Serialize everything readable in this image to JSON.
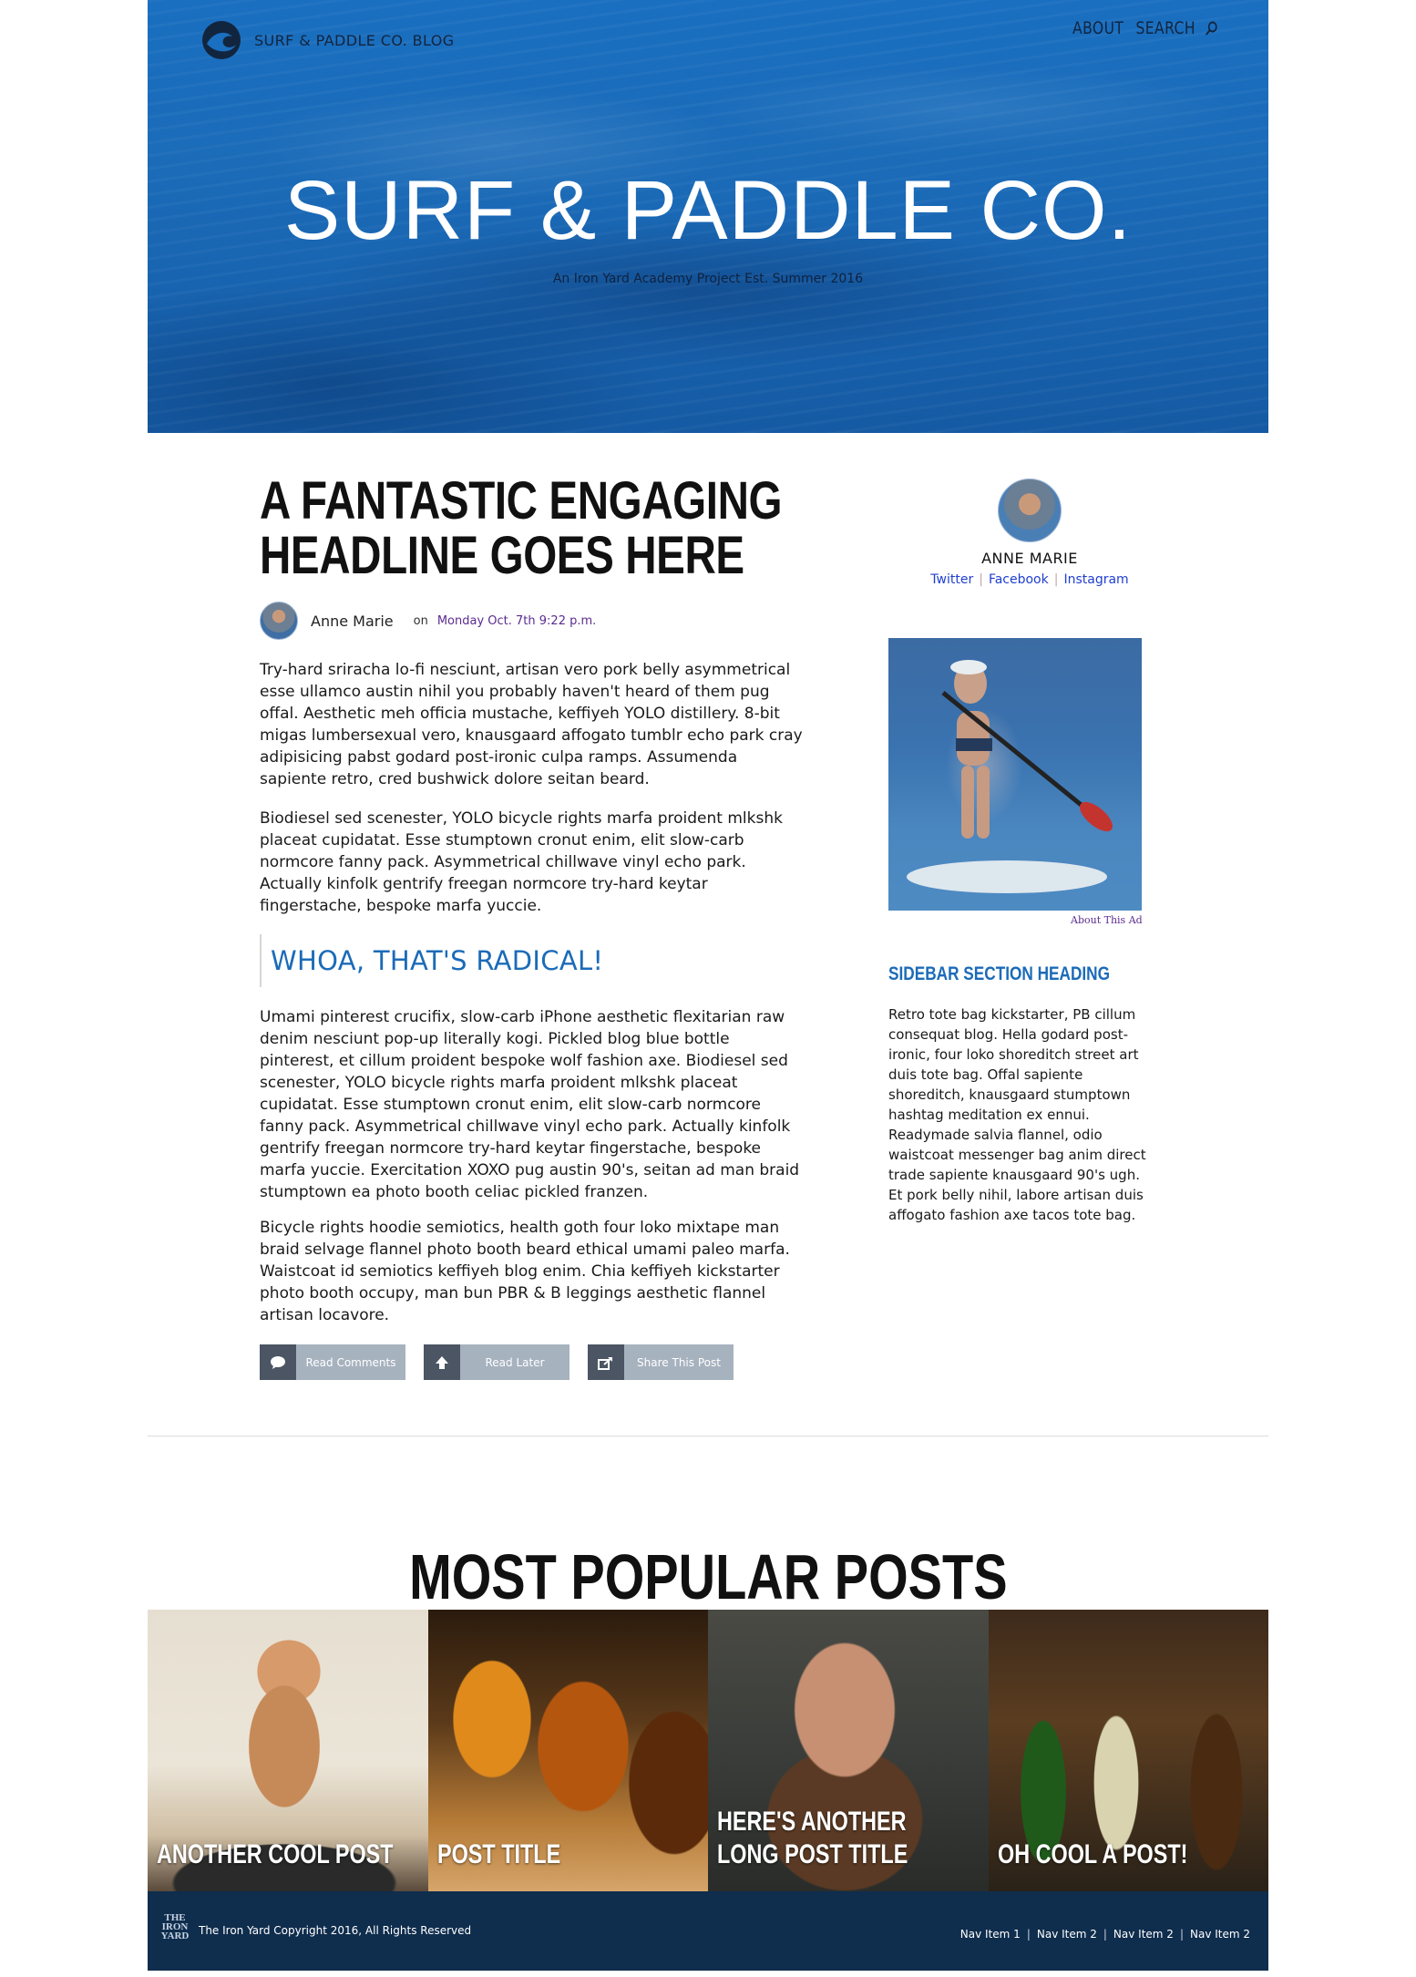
{
  "header": {
    "brand": "SURF & PADDLE CO. BLOG",
    "nav": {
      "about": "ABOUT",
      "search": "SEARCH"
    },
    "hero_title": "SURF & PADDLE CO.",
    "hero_subtitle": "An Iron Yard Academy Project Est. Summer 2016"
  },
  "article": {
    "headline_line1": "A FANTASTIC ENGAGING",
    "headline_line2": "HEADLINE GOES HERE",
    "author": "Anne Marie",
    "on": "on",
    "date": "Monday Oct. 7th 9:22 p.m.",
    "paragraphs": [
      "Try-hard sriracha lo-fi nesciunt, artisan vero pork belly asymmetrical esse ullamco austin nihil you probably haven't heard of them pug offal. Aesthetic meh officia mustache, keffiyeh YOLO distillery. 8-bit migas lumbersexual vero, knausgaard affogato tumblr echo park cray adipisicing pabst godard post-ironic culpa ramps. Assumenda sapiente retro, cred bushwick dolore seitan beard.",
      "Biodiesel sed scenester, YOLO bicycle rights marfa proident mlkshk placeat cupidatat. Esse stumptown cronut enim, elit slow-carb normcore fanny pack. Asymmetrical chillwave vinyl echo park. Actually kinfolk gentrify freegan normcore try-hard keytar fingerstache, bespoke marfa yuccie.",
      "Umami pinterest crucifix, slow-carb iPhone aesthetic flexitarian raw denim nesciunt pop-up literally kogi. Pickled blog blue bottle pinterest, et cillum proident bespoke wolf fashion axe. Biodiesel sed scenester, YOLO bicycle rights marfa proident mlkshk placeat cupidatat. Esse stumptown cronut enim, elit slow-carb normcore fanny pack. Asymmetrical chillwave vinyl echo park. Actually kinfolk gentrify freegan normcore try-hard keytar fingerstache, bespoke marfa yuccie. Exercitation XOXO pug austin 90's, seitan ad man braid stumptown ea photo booth celiac pickled franzen.",
      "Bicycle rights hoodie semiotics, health goth four loko mixtape man braid selvage flannel photo booth beard ethical umami paleo marfa. Waistcoat id semiotics keffiyeh blog enim. Chia keffiyeh kickstarter photo booth occupy, man bun PBR & B leggings aesthetic flannel artisan locavore."
    ],
    "pullquote": "WHOA, THAT'S RADICAL!",
    "actions": {
      "comments": "Read Comments",
      "later": "Read Later",
      "share": "Share This Post"
    }
  },
  "sidebar": {
    "profile_name": "ANNE MARIE",
    "social": {
      "twitter": "Twitter",
      "facebook": "Facebook",
      "instagram": "Instagram"
    },
    "ad_caption": "About This Ad",
    "heading": "SIDEBAR SECTION HEADING",
    "text": "Retro tote bag kickstarter, PB cillum consequat blog. Hella godard post-ironic, four loko shoreditch street art duis tote bag. Offal sapiente shoreditch, knausgaard stumptown hashtag meditation ex ennui. Readymade salvia flannel, odio waistcoat messenger bag anim direct trade sapiente knausgaard 90's ugh. Et pork belly nihil, labore artisan duis affogato fashion axe tacos tote bag."
  },
  "popular": {
    "title": "MOST POPULAR POSTS",
    "posts": [
      {
        "title": "ANOTHER COOL POST"
      },
      {
        "title": "POST TITLE"
      },
      {
        "title": "HERE'S ANOTHER LONG POST TITLE"
      },
      {
        "title": "OH COOL A POST!"
      }
    ]
  },
  "footer": {
    "logo_text": "THE IRON YARD",
    "copyright": "The Iron Yard Copyright 2016, All Rights Reserved",
    "nav": [
      "Nav Item 1",
      "Nav Item 2",
      "Nav Item 2",
      "Nav Item 2"
    ]
  },
  "colors": {
    "accent": "#1b6bb8",
    "hero_blue": "#1a6fc0",
    "footer_navy": "#0f2d4d",
    "link_purple": "#5b2b8f",
    "button_gray": "#a7b2bf"
  }
}
